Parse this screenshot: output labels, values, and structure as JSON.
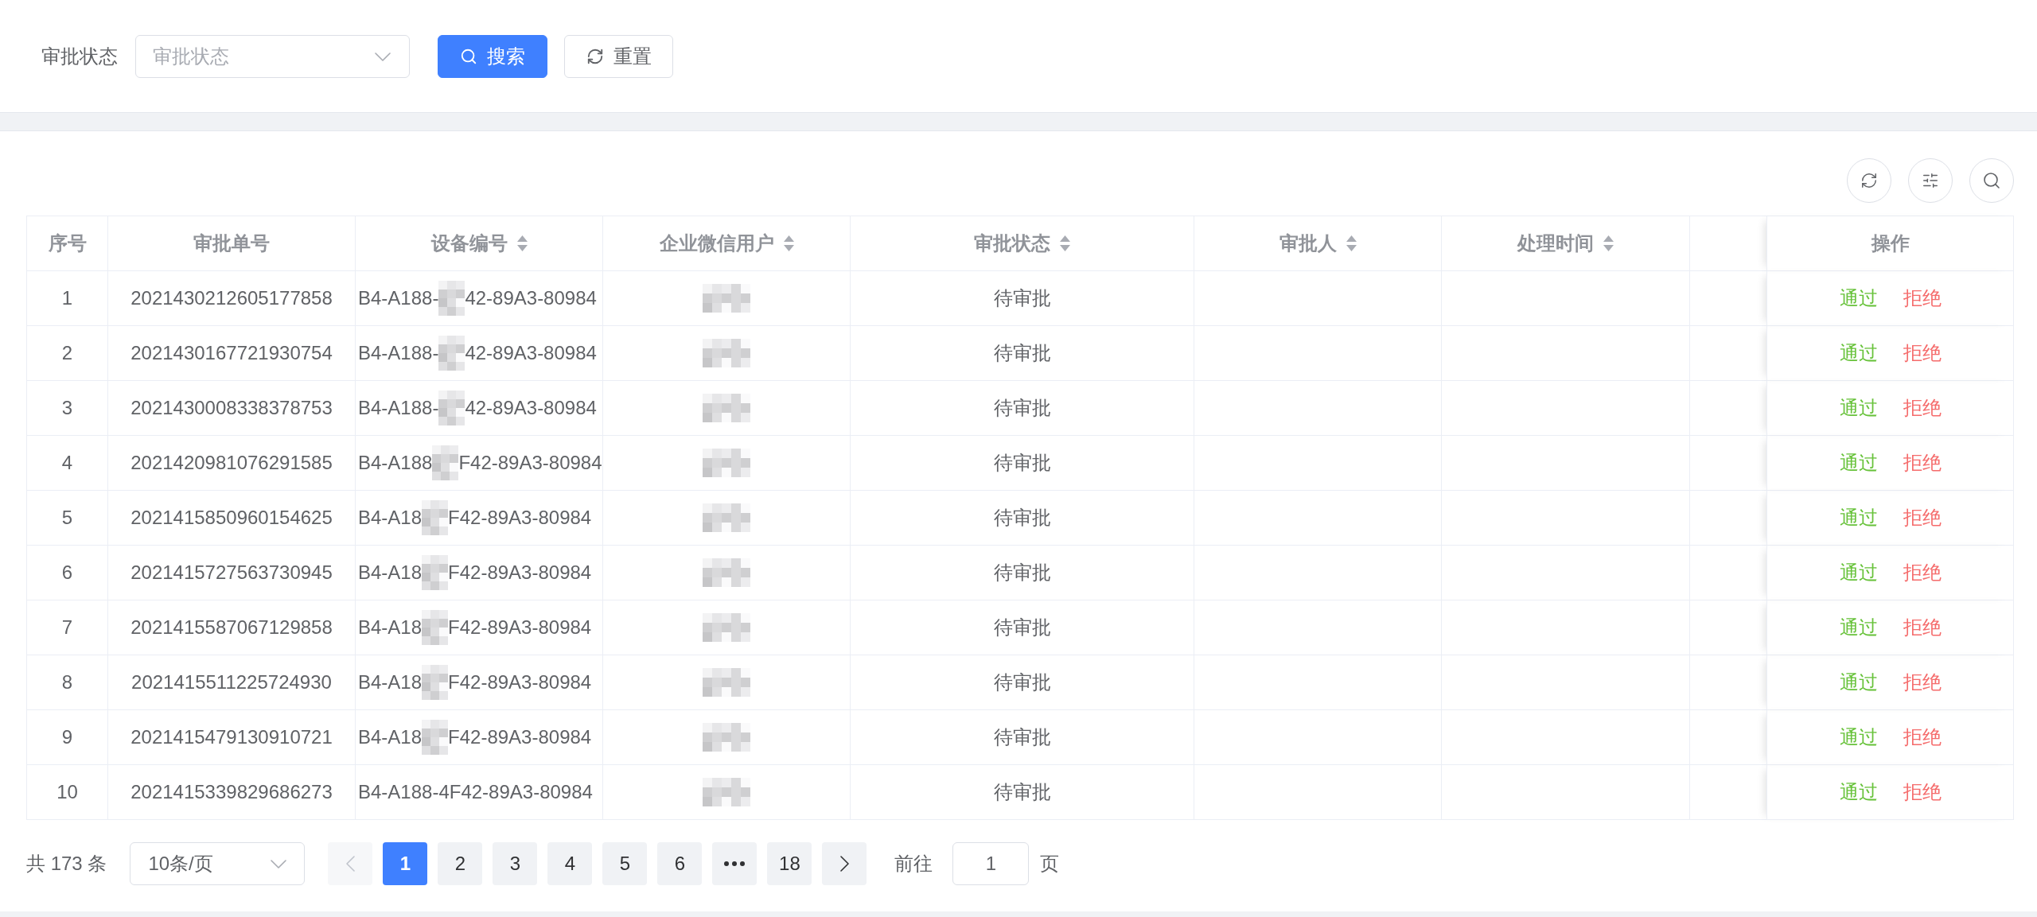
{
  "filter": {
    "label": "审批状态",
    "select": {
      "placeholder": "审批状态"
    },
    "buttons": [
      {
        "kind": "search",
        "label": "搜索"
      },
      {
        "kind": "reset",
        "label": "重置"
      }
    ]
  },
  "table": {
    "columns": [
      {
        "label": "序号",
        "sortable": false
      },
      {
        "label": "审批单号",
        "sortable": false
      },
      {
        "label": "设备编号",
        "sortable": true
      },
      {
        "label": "企业微信用户",
        "sortable": true
      },
      {
        "label": "审批状态",
        "sortable": true
      },
      {
        "label": "审批人",
        "sortable": true
      },
      {
        "label": "处理时间",
        "sortable": true
      },
      {
        "label": "操作",
        "sortable": false
      }
    ],
    "rows": [
      {
        "index": "1",
        "approval_no": "2021430212605177858",
        "device_id": [
          "B4-A188-",
          "42-89A3-80984"
        ],
        "user_redacted": true,
        "status": "待审批",
        "actions": [
          {
            "kind": "approve",
            "label": "通过"
          },
          {
            "kind": "reject",
            "label": "拒绝"
          }
        ]
      },
      {
        "index": "2",
        "approval_no": "2021430167721930754",
        "device_id": [
          "B4-A188-",
          "42-89A3-80984"
        ],
        "user_redacted": true,
        "status": "待审批",
        "actions": [
          {
            "kind": "approve",
            "label": "通过"
          },
          {
            "kind": "reject",
            "label": "拒绝"
          }
        ]
      },
      {
        "index": "3",
        "approval_no": "2021430008338378753",
        "device_id": [
          "B4-A188-",
          "42-89A3-80984"
        ],
        "user_redacted": true,
        "status": "待审批",
        "actions": [
          {
            "kind": "approve",
            "label": "通过"
          },
          {
            "kind": "reject",
            "label": "拒绝"
          }
        ]
      },
      {
        "index": "4",
        "approval_no": "2021420981076291585",
        "device_id": [
          "B4-A188",
          "F42-89A3-80984"
        ],
        "user_redacted": true,
        "status": "待审批",
        "actions": [
          {
            "kind": "approve",
            "label": "通过"
          },
          {
            "kind": "reject",
            "label": "拒绝"
          }
        ]
      },
      {
        "index": "5",
        "approval_no": "2021415850960154625",
        "device_id": [
          "B4-A18",
          "F42-89A3-80984"
        ],
        "user_redacted": true,
        "status": "待审批",
        "actions": [
          {
            "kind": "approve",
            "label": "通过"
          },
          {
            "kind": "reject",
            "label": "拒绝"
          }
        ]
      },
      {
        "index": "6",
        "approval_no": "2021415727563730945",
        "device_id": [
          "B4-A18",
          "F42-89A3-80984"
        ],
        "user_redacted": true,
        "status": "待审批",
        "actions": [
          {
            "kind": "approve",
            "label": "通过"
          },
          {
            "kind": "reject",
            "label": "拒绝"
          }
        ]
      },
      {
        "index": "7",
        "approval_no": "2021415587067129858",
        "device_id": [
          "B4-A18",
          "F42-89A3-80984"
        ],
        "user_redacted": true,
        "status": "待审批",
        "actions": [
          {
            "kind": "approve",
            "label": "通过"
          },
          {
            "kind": "reject",
            "label": "拒绝"
          }
        ]
      },
      {
        "index": "8",
        "approval_no": "2021415511225724930",
        "device_id": [
          "B4-A18",
          "F42-89A3-80984"
        ],
        "user_redacted": true,
        "status": "待审批",
        "actions": [
          {
            "kind": "approve",
            "label": "通过"
          },
          {
            "kind": "reject",
            "label": "拒绝"
          }
        ]
      },
      {
        "index": "9",
        "approval_no": "2021415479130910721",
        "device_id": [
          "B4-A18",
          "F42-89A3-80984"
        ],
        "user_redacted": true,
        "status": "待审批",
        "actions": [
          {
            "kind": "approve",
            "label": "通过"
          },
          {
            "kind": "reject",
            "label": "拒绝"
          }
        ]
      },
      {
        "index": "10",
        "approval_no": "2021415339829686273",
        "device_id": [
          "B4-A188-4F42-89A3-80984"
        ],
        "user_redacted": true,
        "status": "待审批",
        "actions": [
          {
            "kind": "approve",
            "label": "通过"
          },
          {
            "kind": "reject",
            "label": "拒绝"
          }
        ]
      }
    ]
  },
  "pagination": {
    "total": "共 173 条",
    "page_size": "10条/页",
    "prev": {
      "disabled": true
    },
    "pages": [
      {
        "kind": "page",
        "label": "1",
        "selected": true
      },
      {
        "kind": "page",
        "label": "2",
        "selected": false
      },
      {
        "kind": "page",
        "label": "3",
        "selected": false
      },
      {
        "kind": "page",
        "label": "4",
        "selected": false
      },
      {
        "kind": "page",
        "label": "5",
        "selected": false
      },
      {
        "kind": "page",
        "label": "6",
        "selected": false
      },
      {
        "kind": "more",
        "selected": false
      },
      {
        "kind": "page",
        "label": "18",
        "selected": false
      }
    ],
    "next": {
      "disabled": false
    },
    "jump_label": "前往",
    "jump_value": "1",
    "jump_suffix": "页"
  }
}
